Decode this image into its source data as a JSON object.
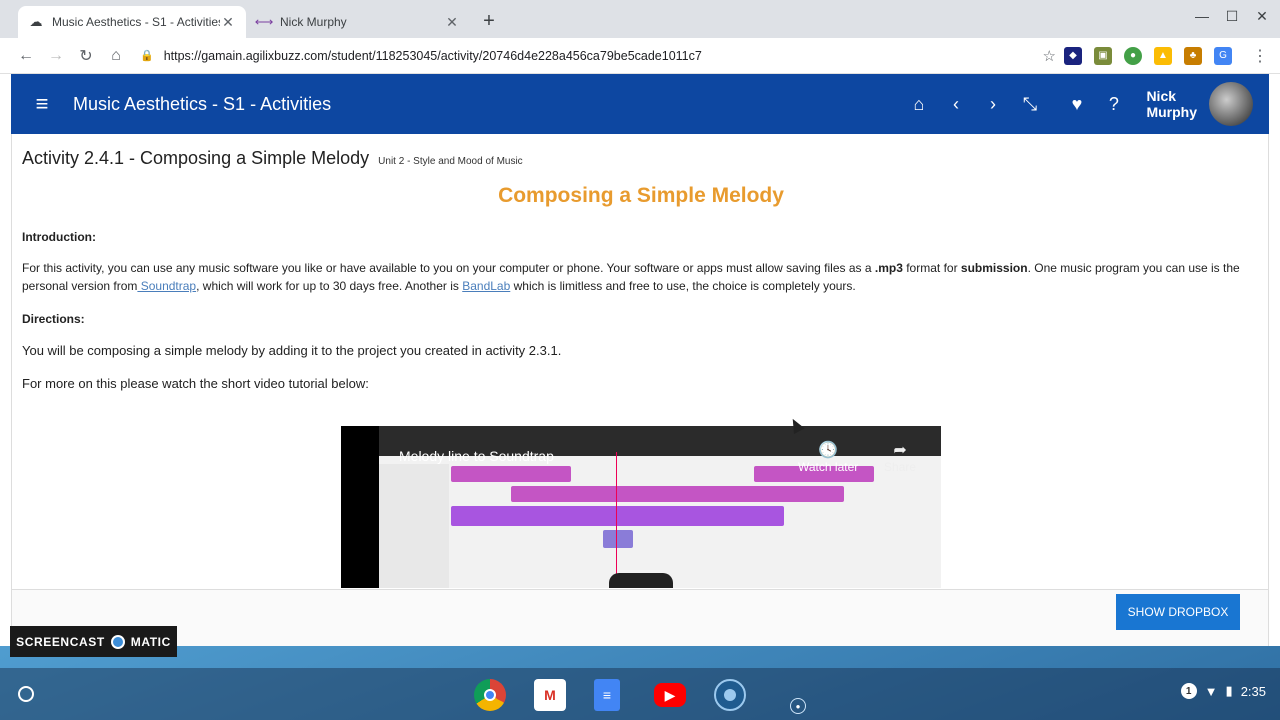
{
  "browser": {
    "tabs": [
      {
        "title": "Music Aesthetics - S1 - Activities",
        "active": true,
        "icon": "agilix-icon"
      },
      {
        "title": "Nick Murphy",
        "active": false,
        "icon": "link-icon"
      }
    ],
    "url": "https://gamain.agilixbuzz.com/student/118253045/activity/20746d4e228a456ca79be5cade1011c7"
  },
  "app": {
    "title": "Music Aesthetics - S1 - Activities",
    "user_first": "Nick",
    "user_last": "Murphy"
  },
  "content": {
    "activity_title": "Activity 2.4.1 - Composing a Simple Melody",
    "unit": "Unit 2 - Style and Mood of Music",
    "heading": "Composing a Simple Melody",
    "intro_label": "Introduction:",
    "intro_text_1": "For this activity, you can use any music software you like or have available to you on your computer or phone. Your software or apps must allow saving files as a ",
    "intro_mp3": ".mp3",
    "intro_text_2": " format for ",
    "intro_submission": "submission",
    "intro_text_3": ". One music program you can use is the personal version from",
    "link_soundtrap": " Soundtrap",
    "intro_text_4": ", which will work for up to 30 days free. Another is ",
    "link_bandlab": "BandLab",
    "intro_text_5": " which is limitless and free to use, the choice is completely yours.",
    "directions_label": "Directions:",
    "directions_text": "You will be composing a simple melody by adding it to the project you created in activity 2.3.1.",
    "more_text": "For more on this please watch the short video tutorial below:",
    "video_title": "Melody line to Soundtrap",
    "watch_later": "Watch later",
    "share": "Share",
    "dropbox_button": "SHOW DROPBOX"
  },
  "overlay": {
    "watermark_left": "SCREENCAST",
    "watermark_right": "MATIC"
  },
  "shelf": {
    "notification_count": "1",
    "time": "2:35"
  }
}
